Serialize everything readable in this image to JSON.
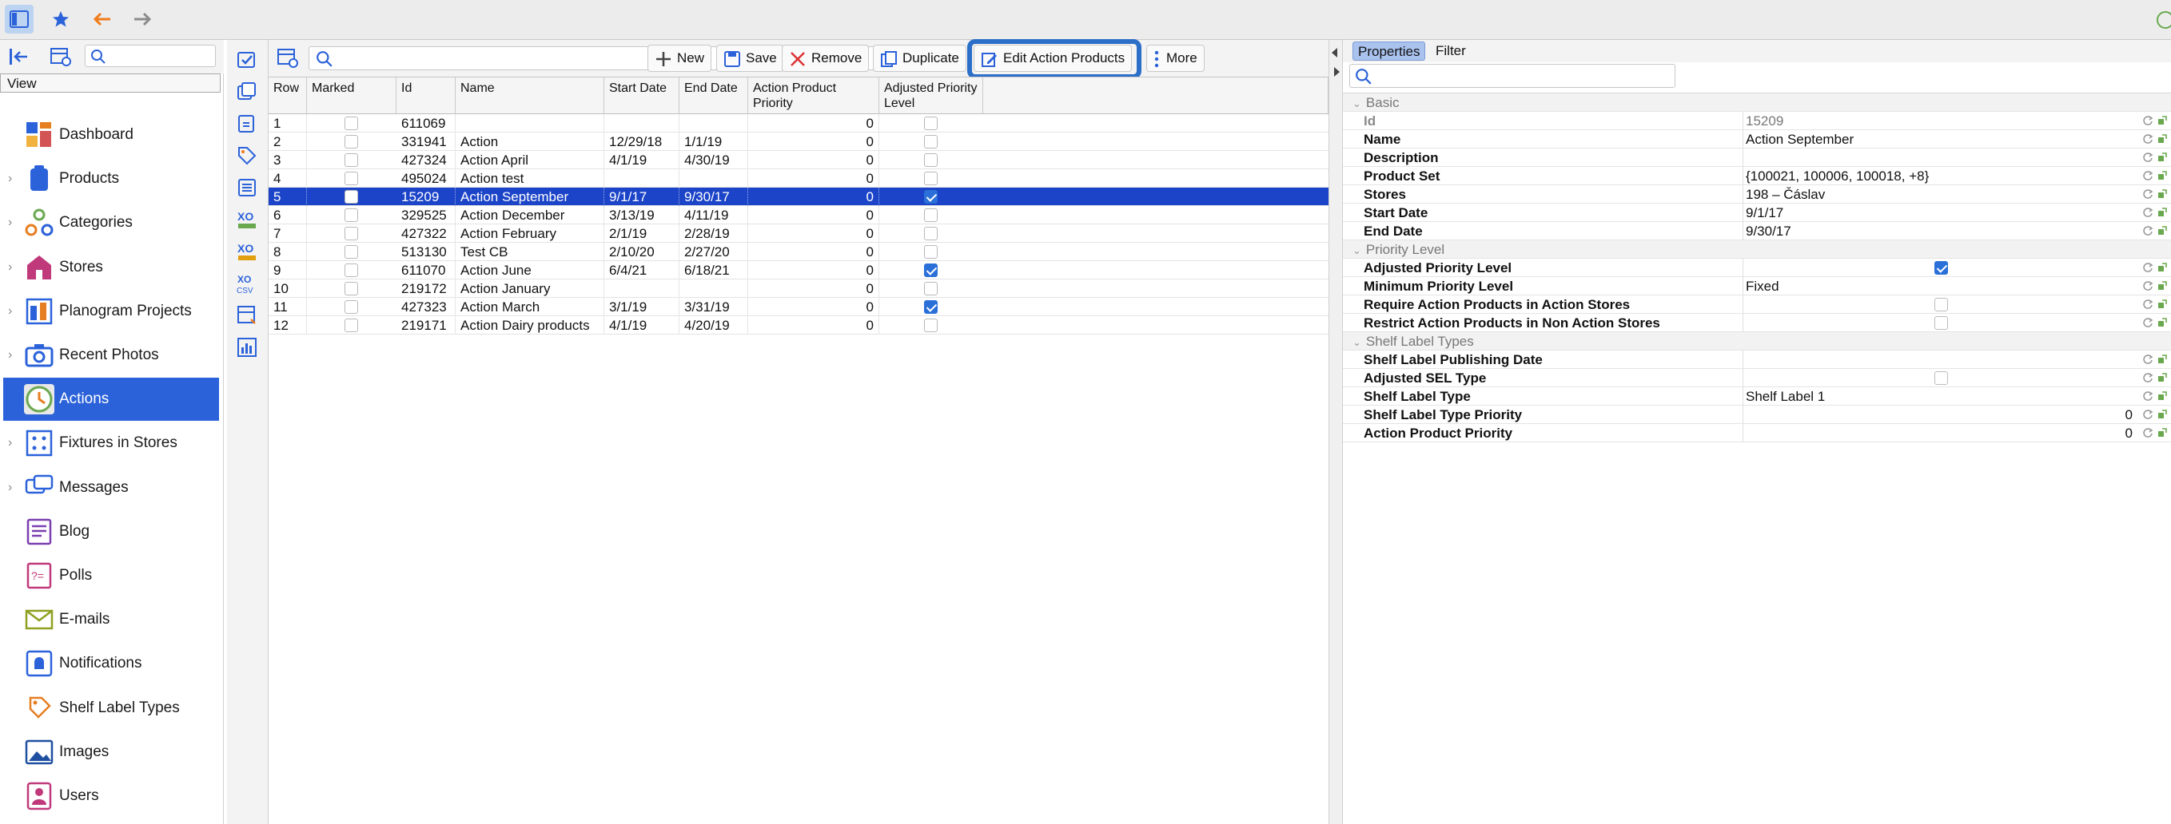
{
  "sidebar": {
    "view_label": "View",
    "items": [
      {
        "label": "Dashboard",
        "icon": "dashboard-icon",
        "chevron": false
      },
      {
        "label": "Products",
        "icon": "products-icon",
        "chevron": true
      },
      {
        "label": "Categories",
        "icon": "categories-icon",
        "chevron": true
      },
      {
        "label": "Stores",
        "icon": "stores-icon",
        "chevron": true
      },
      {
        "label": "Planogram Projects",
        "icon": "planogram-icon",
        "chevron": true
      },
      {
        "label": "Recent Photos",
        "icon": "camera-icon",
        "chevron": true
      },
      {
        "label": "Actions",
        "icon": "clock-icon",
        "chevron": false,
        "active": true
      },
      {
        "label": "Fixtures in Stores",
        "icon": "fixtures-icon",
        "chevron": true
      },
      {
        "label": "Messages",
        "icon": "messages-icon",
        "chevron": true
      },
      {
        "label": "Blog",
        "icon": "blog-icon",
        "chevron": false
      },
      {
        "label": "Polls",
        "icon": "polls-icon",
        "chevron": false
      },
      {
        "label": "E-mails",
        "icon": "email-icon",
        "chevron": false
      },
      {
        "label": "Notifications",
        "icon": "bell-icon",
        "chevron": false
      },
      {
        "label": "Shelf Label Types",
        "icon": "label-icon",
        "chevron": false
      },
      {
        "label": "Images",
        "icon": "image-icon",
        "chevron": false
      },
      {
        "label": "Users",
        "icon": "user-icon",
        "chevron": false
      }
    ]
  },
  "toolbar": {
    "new_label": "New",
    "save_label": "Save",
    "remove_label": "Remove",
    "duplicate_label": "Duplicate",
    "edit_action_products_label": "Edit Action Products",
    "more_label": "More"
  },
  "table": {
    "columns": [
      "Row",
      "Marked",
      "Id",
      "Name",
      "Start Date",
      "End Date",
      "Action Product Priority",
      "Adjusted Priority Level"
    ],
    "rows": [
      {
        "row": "1",
        "marked": false,
        "id": "611069",
        "name": "",
        "start": "",
        "end": "",
        "priority": "0",
        "adjusted": false
      },
      {
        "row": "2",
        "marked": false,
        "id": "331941",
        "name": "Action",
        "start": "12/29/18",
        "end": "1/1/19",
        "priority": "0",
        "adjusted": false
      },
      {
        "row": "3",
        "marked": false,
        "id": "427324",
        "name": "Action April",
        "start": "4/1/19",
        "end": "4/30/19",
        "priority": "0",
        "adjusted": false
      },
      {
        "row": "4",
        "marked": false,
        "id": "495024",
        "name": "Action test",
        "start": "",
        "end": "",
        "priority": "0",
        "adjusted": false
      },
      {
        "row": "5",
        "marked": false,
        "id": "15209",
        "name": "Action September",
        "start": "9/1/17",
        "end": "9/30/17",
        "priority": "0",
        "adjusted": true,
        "selected": true
      },
      {
        "row": "6",
        "marked": false,
        "id": "329525",
        "name": "Action December",
        "start": "3/13/19",
        "end": "4/11/19",
        "priority": "0",
        "adjusted": false
      },
      {
        "row": "7",
        "marked": false,
        "id": "427322",
        "name": "Action February",
        "start": "2/1/19",
        "end": "2/28/19",
        "priority": "0",
        "adjusted": false
      },
      {
        "row": "8",
        "marked": false,
        "id": "513130",
        "name": "Test CB",
        "start": "2/10/20",
        "end": "2/27/20",
        "priority": "0",
        "adjusted": false
      },
      {
        "row": "9",
        "marked": false,
        "id": "611070",
        "name": "Action June",
        "start": "6/4/21",
        "end": "6/18/21",
        "priority": "0",
        "adjusted": true
      },
      {
        "row": "10",
        "marked": false,
        "id": "219172",
        "name": "Action January",
        "start": "",
        "end": "",
        "priority": "0",
        "adjusted": false
      },
      {
        "row": "11",
        "marked": false,
        "id": "427323",
        "name": "Action March",
        "start": "3/1/19",
        "end": "3/31/19",
        "priority": "0",
        "adjusted": true
      },
      {
        "row": "12",
        "marked": false,
        "id": "219171",
        "name": "Action Dairy products",
        "start": "4/1/19",
        "end": "4/20/19",
        "priority": "0",
        "adjusted": false
      }
    ]
  },
  "props": {
    "tab_properties": "Properties",
    "tab_filter": "Filter",
    "rows": [
      {
        "type": "cat",
        "key": "Basic"
      },
      {
        "type": "row",
        "key": "Id",
        "value": "15209",
        "disabled": true
      },
      {
        "type": "row",
        "key": "Name",
        "value": "Action September"
      },
      {
        "type": "row",
        "key": "Description",
        "value": ""
      },
      {
        "type": "row",
        "key": "Product Set",
        "value": "{100021, 100006, 100018, +8}"
      },
      {
        "type": "row",
        "key": "Stores",
        "value": "198 – Čáslav"
      },
      {
        "type": "row",
        "key": "Start Date",
        "value": "9/1/17"
      },
      {
        "type": "row",
        "key": "End Date",
        "value": "9/30/17"
      },
      {
        "type": "cat",
        "key": "Priority Level"
      },
      {
        "type": "row",
        "key": "Adjusted Priority Level",
        "check": true
      },
      {
        "type": "row",
        "key": "Minimum Priority Level",
        "value": "Fixed"
      },
      {
        "type": "row",
        "key": "Require Action Products in Action Stores",
        "check": false
      },
      {
        "type": "row",
        "key": "Restrict Action Products in Non Action Stores",
        "check": false
      },
      {
        "type": "cat",
        "key": "Shelf Label Types"
      },
      {
        "type": "row",
        "key": "Shelf Label Publishing Date",
        "value": ""
      },
      {
        "type": "row",
        "key": "Adjusted SEL Type",
        "check": false
      },
      {
        "type": "row",
        "key": "Shelf Label Type",
        "value": "Shelf Label 1"
      },
      {
        "type": "row",
        "key": "Shelf Label Type Priority",
        "rvalue": "0"
      },
      {
        "type": "row",
        "key": "Action Product Priority",
        "rvalue": "0"
      }
    ]
  },
  "colors": {
    "accent": "#2b62d9",
    "selection": "#1b44c8",
    "highlight_frame": "#2c6fc8",
    "back_arrow": "#f07b1a"
  }
}
